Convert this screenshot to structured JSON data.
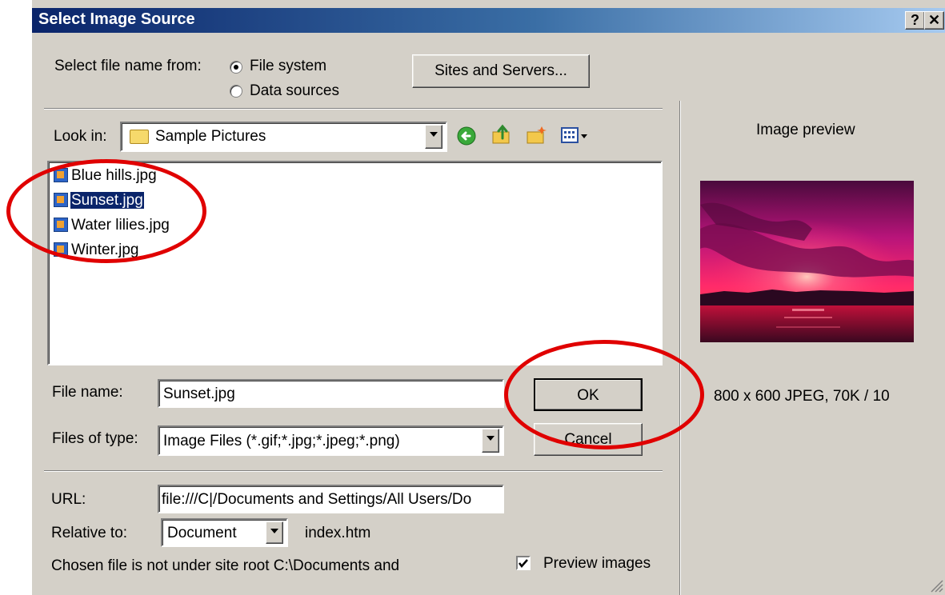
{
  "window": {
    "title": "Select Image Source"
  },
  "source": {
    "label": "Select file name from:",
    "options": [
      {
        "label": "File system",
        "selected": true
      },
      {
        "label": "Data sources",
        "selected": false
      }
    ],
    "sites_button": "Sites and Servers..."
  },
  "lookin": {
    "label": "Look in:",
    "value": "Sample Pictures"
  },
  "files": [
    {
      "name": "Blue hills.jpg",
      "selected": false
    },
    {
      "name": "Sunset.jpg",
      "selected": true
    },
    {
      "name": "Water lilies.jpg",
      "selected": false
    },
    {
      "name": "Winter.jpg",
      "selected": false
    }
  ],
  "filename": {
    "label": "File name:",
    "value": "Sunset.jpg"
  },
  "filetype": {
    "label": "Files of type:",
    "value": "Image Files (*.gif;*.jpg;*.jpeg;*.png)"
  },
  "buttons": {
    "ok": "OK",
    "cancel": "Cancel"
  },
  "url": {
    "label": "URL:",
    "value": "file:///C|/Documents and Settings/All Users/Do"
  },
  "relative": {
    "label": "Relative to:",
    "value": "Document",
    "page": "index.htm"
  },
  "note": "Chosen file is not under site root C:\\Documents and",
  "preview": {
    "label": "Image preview",
    "info": "800 x 600 JPEG, 70K / 10",
    "checkbox_label": "Preview images",
    "checked": true
  },
  "colors": {
    "titlebar_start": "#0a246a",
    "titlebar_end": "#a6caf0",
    "selection": "#0a246a",
    "annotation": "#e00000"
  }
}
